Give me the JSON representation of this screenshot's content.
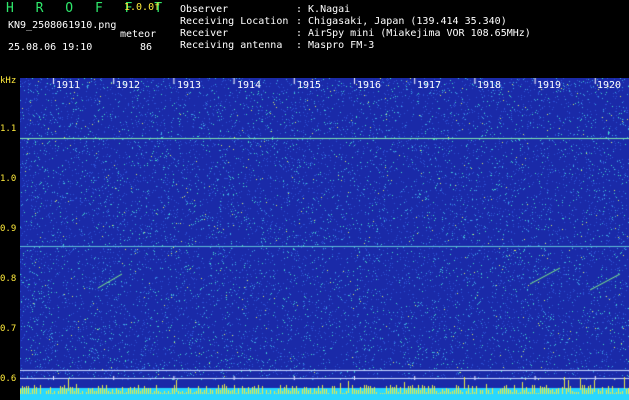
{
  "header": {
    "brand": "H R O F F T",
    "version": "1.0.0f",
    "filename": "KN9_2508061910.png",
    "meteor_label": "meteor",
    "datetime": "25.08.06 19:10",
    "meteor_count": "86",
    "info": [
      {
        "label": "Observer",
        "value": ": K.Nagai"
      },
      {
        "label": "Receiving Location",
        "value": ": Chigasaki, Japan (139.414 35.340)"
      },
      {
        "label": "Receiver",
        "value": ": AirSpy mini (Miakejima VOR 108.65MHz)"
      },
      {
        "label": "Receiving antenna",
        "value": ": Maspro FM-3"
      }
    ]
  },
  "axis": {
    "unit": "kHz",
    "y_ticks": [
      "1.1",
      "1.0",
      "0.9",
      "0.8",
      "0.7",
      "0.6"
    ],
    "time_ticks": [
      "1911",
      "1912",
      "1913",
      "1914",
      "1915",
      "1916",
      "1917",
      "1918",
      "1919",
      "1920"
    ]
  },
  "colors": {
    "background": "#1a2aa8",
    "accent": "#2ee86b",
    "label": "#ffeb3b",
    "cyan": "#29d7ff"
  }
}
